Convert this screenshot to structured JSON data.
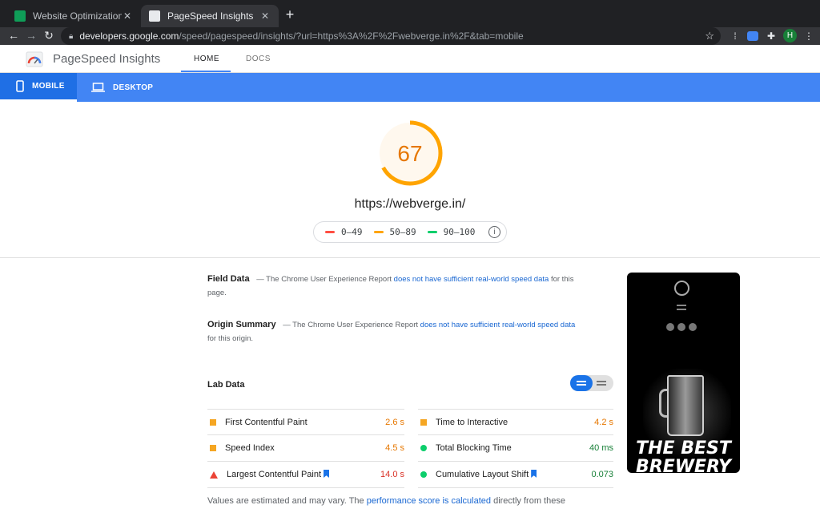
{
  "browser": {
    "tabs": [
      {
        "title": "Website Optimization - Google",
        "favicon_color": "#0f9d58"
      },
      {
        "title": "PageSpeed Insights",
        "favicon_color": "#e8eaed"
      }
    ],
    "url_host": "developers.google.com",
    "url_path": "/speed/pagespeed/insights/?url=https%3A%2F%2Fwebverge.in%2F&tab=mobile",
    "avatar_initial": "H"
  },
  "header": {
    "brand": "PageSpeed Insights",
    "nav": [
      "HOME",
      "DOCS"
    ]
  },
  "devices": {
    "mobile": "MOBILE",
    "desktop": "DESKTOP"
  },
  "score": {
    "value": 67,
    "url": "https://webverge.in/",
    "legend": [
      "0–49",
      "50–89",
      "90–100"
    ],
    "legend_colors": [
      "#ff4e42",
      "#ffa400",
      "#0cce6b"
    ],
    "score_color": "#ffa400"
  },
  "field_data": {
    "title": "Field Data",
    "prefix": "— The Chrome User Experience Report",
    "link": "does not have sufficient real-world speed data",
    "suffix": "for this page."
  },
  "origin_summary": {
    "title": "Origin Summary",
    "prefix": "— The Chrome User Experience Report",
    "link": "does not have sufficient real-world speed data",
    "suffix": "for this origin."
  },
  "lab_data": {
    "title": "Lab Data",
    "metrics": [
      {
        "name": "First Contentful Paint",
        "value": "2.6 s",
        "status": "average"
      },
      {
        "name": "Time to Interactive",
        "value": "4.2 s",
        "status": "average"
      },
      {
        "name": "Speed Index",
        "value": "4.5 s",
        "status": "average"
      },
      {
        "name": "Total Blocking Time",
        "value": "40 ms",
        "status": "good"
      },
      {
        "name": "Largest Contentful Paint",
        "value": "14.0 s",
        "status": "poor"
      },
      {
        "name": "Cumulative Layout Shift",
        "value": "0.073",
        "status": "good"
      }
    ]
  },
  "note": {
    "prefix": "Values are estimated and may vary. The",
    "link": "performance score is calculated",
    "suffix": "directly from these"
  },
  "thumbnail": {
    "headline_line1": "THE BEST",
    "headline_line2": "BREWERY"
  }
}
